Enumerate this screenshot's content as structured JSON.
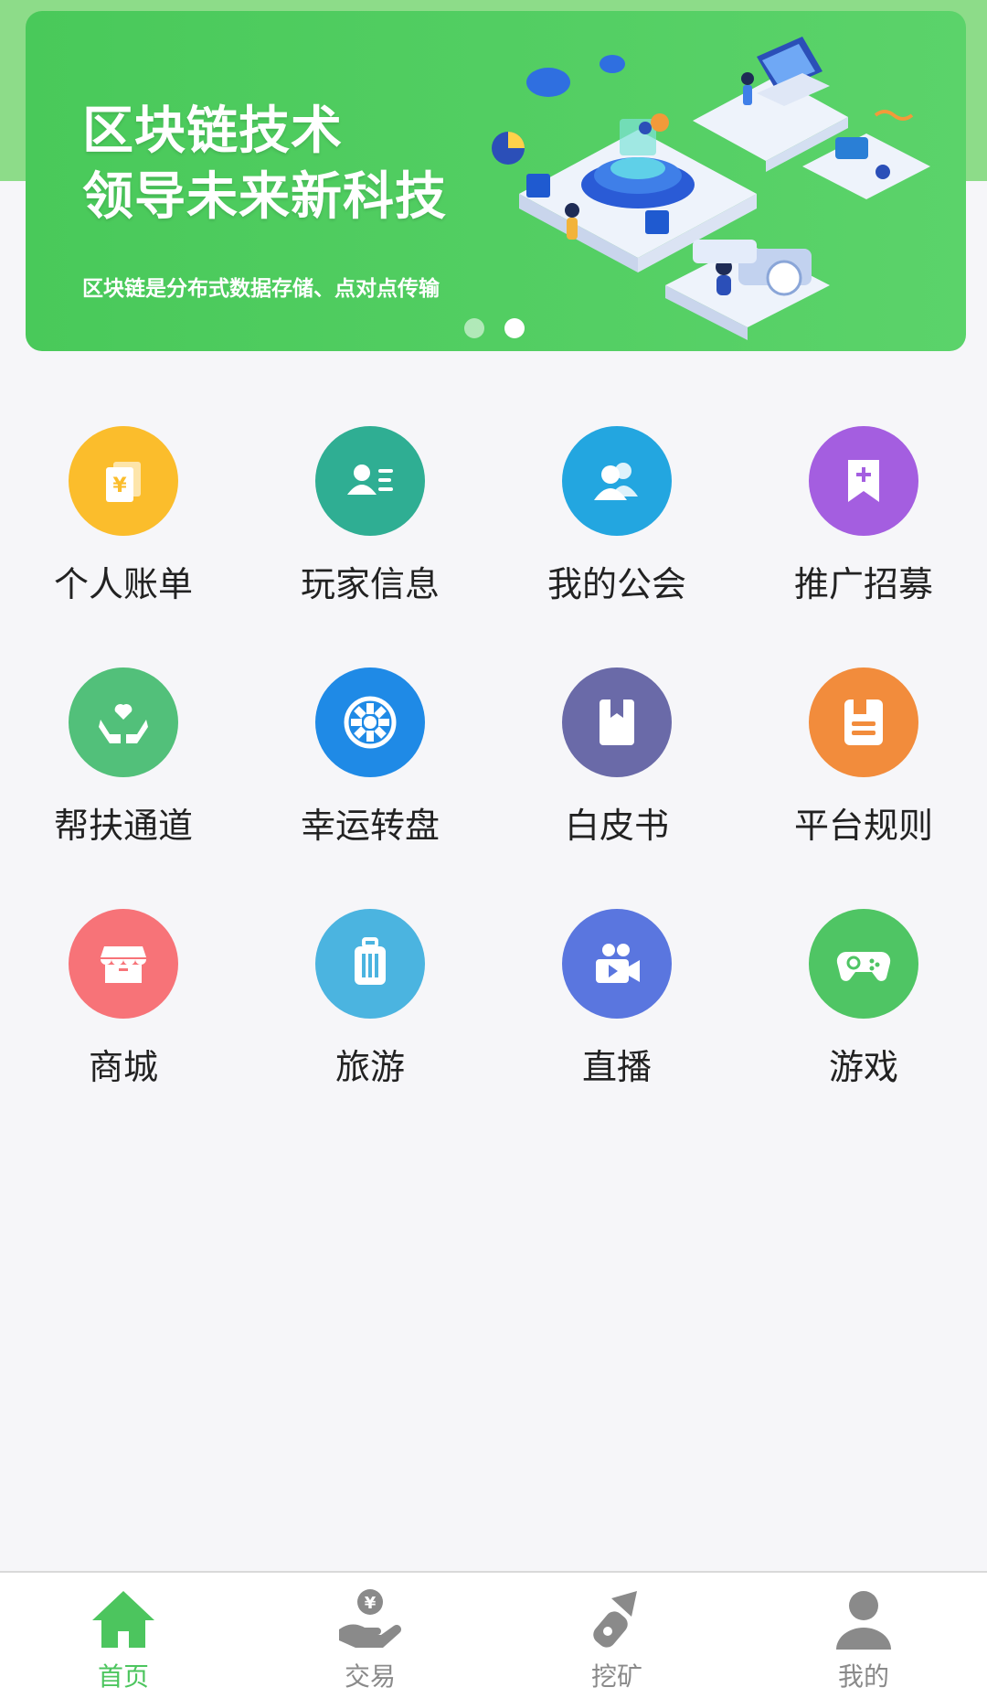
{
  "banner": {
    "title_line1": "区块链技术",
    "title_line2": "领导未来新科技",
    "subtitle": "区块链是分布式数据存储、点对点传输",
    "slides": 2,
    "active_slide": 2
  },
  "menu": [
    {
      "label": "个人账单",
      "icon": "bill-icon",
      "color": "#fbbd2c"
    },
    {
      "label": "玩家信息",
      "icon": "player-info-icon",
      "color": "#2fae93"
    },
    {
      "label": "我的公会",
      "icon": "guild-icon",
      "color": "#23a6e0"
    },
    {
      "label": "推广招募",
      "icon": "promote-icon",
      "color": "#a45ee0"
    },
    {
      "label": "帮扶通道",
      "icon": "help-icon",
      "color": "#52c07a"
    },
    {
      "label": "幸运转盘",
      "icon": "wheel-icon",
      "color": "#1f8ae6"
    },
    {
      "label": "白皮书",
      "icon": "whitepaper-icon",
      "color": "#6a6aa8"
    },
    {
      "label": "平台规则",
      "icon": "rules-icon",
      "color": "#f28c3c"
    },
    {
      "label": "商城",
      "icon": "shop-icon",
      "color": "#f77378"
    },
    {
      "label": "旅游",
      "icon": "travel-icon",
      "color": "#4bb4e0"
    },
    {
      "label": "直播",
      "icon": "live-icon",
      "color": "#5a76df"
    },
    {
      "label": "游戏",
      "icon": "game-icon",
      "color": "#4fc564"
    }
  ],
  "tabbar": [
    {
      "label": "首页",
      "icon": "home-icon",
      "active": true
    },
    {
      "label": "交易",
      "icon": "trade-icon",
      "active": false
    },
    {
      "label": "挖矿",
      "icon": "mining-icon",
      "active": false
    },
    {
      "label": "我的",
      "icon": "profile-icon",
      "active": false
    }
  ],
  "colors": {
    "accent": "#4cc55e",
    "inactive": "#8a8a8a",
    "background": "#f6f6f9"
  }
}
